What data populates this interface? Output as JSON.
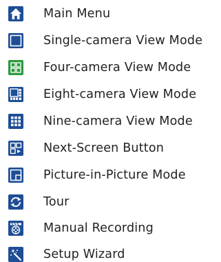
{
  "colors": {
    "blue_icon": "#1f4e96",
    "green_icon": "#2c9b3e",
    "text": "#222222"
  },
  "items": [
    {
      "label": "Main Menu",
      "icon": "home-icon"
    },
    {
      "label": "Single-camera View Mode",
      "icon": "single-view-icon"
    },
    {
      "label": "Four-camera View Mode",
      "icon": "quad-view-icon"
    },
    {
      "label": "Eight-camera View Mode",
      "icon": "eight-view-icon"
    },
    {
      "label": "Nine-camera View Mode",
      "icon": "nine-view-icon"
    },
    {
      "label": "Next-Screen Button",
      "icon": "next-screen-icon"
    },
    {
      "label": "Picture-in-Picture Mode",
      "icon": "pip-icon"
    },
    {
      "label": "Tour",
      "icon": "tour-icon"
    },
    {
      "label": "Manual Recording",
      "icon": "recording-icon"
    },
    {
      "label": "Setup Wizard",
      "icon": "wizard-icon"
    }
  ]
}
